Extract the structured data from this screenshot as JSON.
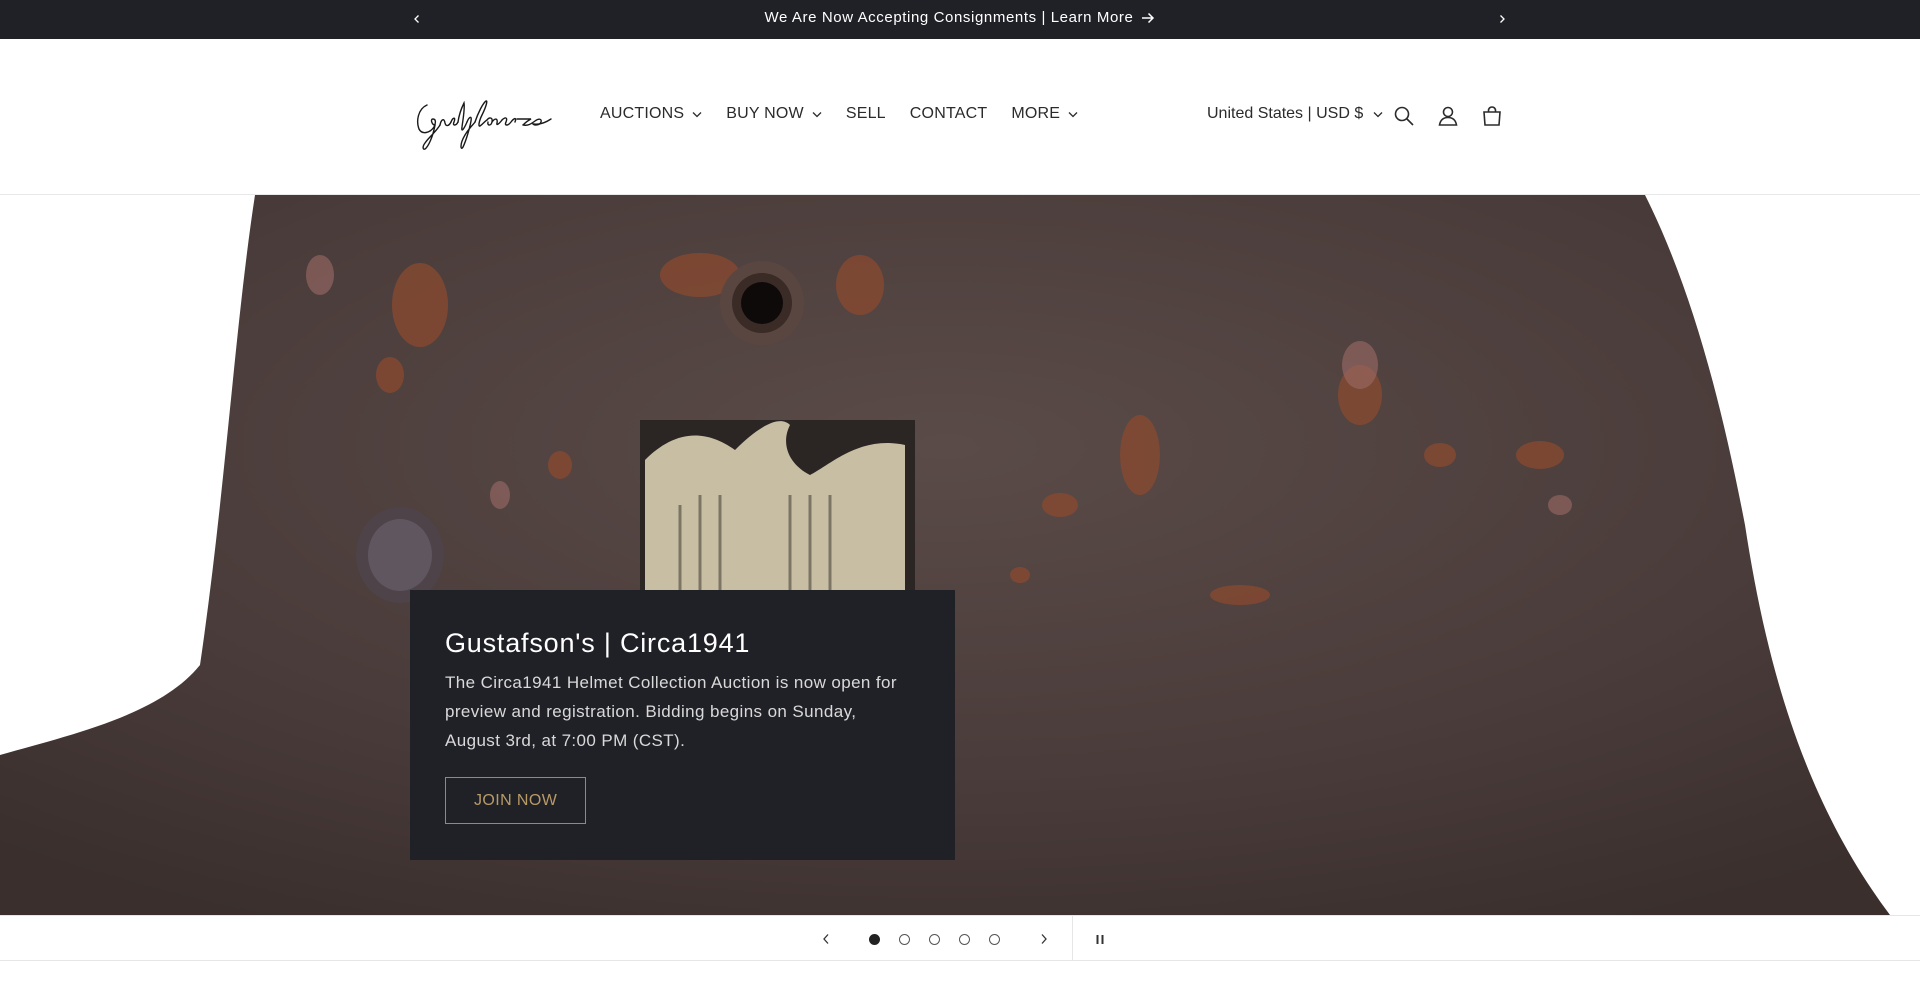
{
  "announcement": {
    "text": "We Are Now Accepting Consignments | Learn More",
    "prev_icon": "chevron-left-icon",
    "next_icon": "chevron-right-icon",
    "arrow_icon": "arrow-right-icon"
  },
  "header": {
    "logo_text": "Gustafson's",
    "nav": [
      {
        "label": "AUCTIONS",
        "has_dropdown": true
      },
      {
        "label": "BUY NOW",
        "has_dropdown": true
      },
      {
        "label": "SELL",
        "has_dropdown": false
      },
      {
        "label": "CONTACT",
        "has_dropdown": false
      },
      {
        "label": "MORE",
        "has_dropdown": true
      }
    ],
    "currency": "United States | USD $",
    "icons": [
      "search-icon",
      "account-icon",
      "cart-icon"
    ]
  },
  "hero": {
    "title": "Gustafson's | Circa1941",
    "text": "The Circa1941 Helmet Collection Auction is now open for preview and registration. Bidding begins on Sunday, August 3rd, at 7:00 PM (CST).",
    "button_label": "JOIN NOW"
  },
  "slider": {
    "slide_count": 5,
    "active_slide": 1
  },
  "colors": {
    "announcement_bg": "#202127",
    "card_bg": "#202127",
    "button_accent": "#b89a67",
    "helmet_base": "#4a3c3a"
  }
}
